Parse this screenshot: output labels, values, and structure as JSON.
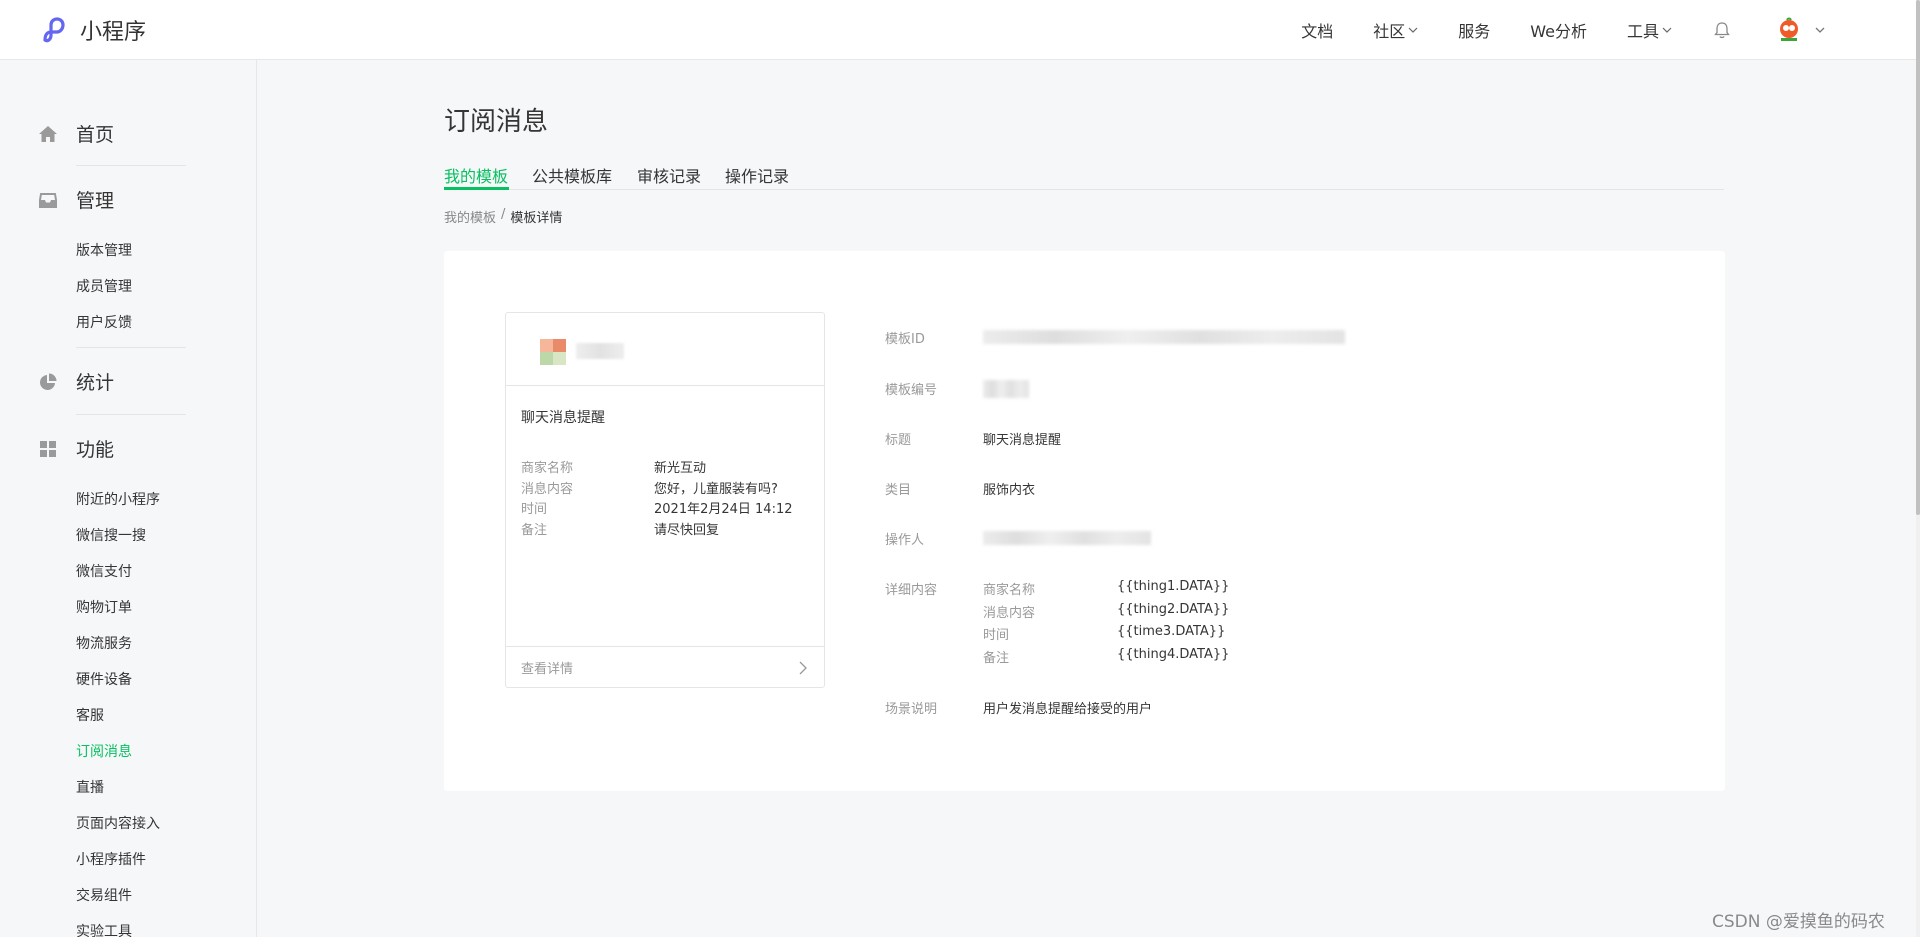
{
  "header": {
    "logo_text": "小程序",
    "nav": [
      {
        "label": "文档",
        "dropdown": false
      },
      {
        "label": "社区",
        "dropdown": true
      },
      {
        "label": "服务",
        "dropdown": false
      },
      {
        "label": "We分析",
        "dropdown": false
      },
      {
        "label": "工具",
        "dropdown": true
      }
    ],
    "icons": {
      "bell": "bell-icon",
      "avatar": "account-avatar",
      "chevron": "chevron-down-icon"
    }
  },
  "sidebar": {
    "home": "首页",
    "manage": {
      "label": "管理",
      "items": [
        "版本管理",
        "成员管理",
        "用户反馈"
      ]
    },
    "stats": "统计",
    "features": {
      "label": "功能",
      "items": [
        "附近的小程序",
        "微信搜一搜",
        "微信支付",
        "购物订单",
        "物流服务",
        "硬件设备",
        "客服",
        "订阅消息",
        "直播",
        "页面内容接入",
        "小程序插件",
        "交易组件",
        "实验工具"
      ],
      "active": "订阅消息"
    }
  },
  "main": {
    "title": "订阅消息",
    "tabs": [
      "我的模板",
      "公共模板库",
      "审核记录",
      "操作记录"
    ],
    "active_tab": "我的模板",
    "breadcrumb": {
      "parent": "我的模板",
      "separator": "/",
      "current": "模板详情"
    },
    "preview_card": {
      "title": "聊天消息提醒",
      "rows": [
        {
          "key": "商家名称",
          "value": "新光互动"
        },
        {
          "key": "消息内容",
          "value": "您好，儿童服装有吗?"
        },
        {
          "key": "时间",
          "value": "2021年2月24日 14:12"
        },
        {
          "key": "备注",
          "value": "请尽快回复"
        }
      ],
      "footer": "查看详情"
    },
    "details": {
      "template_id_label": "模板ID",
      "template_no_label": "模板编号",
      "title_label": "标题",
      "title_value": "聊天消息提醒",
      "category_label": "类目",
      "category_value": "服饰内衣",
      "operator_label": "操作人",
      "content_label": "详细内容",
      "content_rows": [
        {
          "key": "商家名称",
          "value": "{{thing1.DATA}}"
        },
        {
          "key": "消息内容",
          "value": "{{thing2.DATA}}"
        },
        {
          "key": "时间",
          "value": "{{time3.DATA}}"
        },
        {
          "key": "备注",
          "value": "{{thing4.DATA}}"
        }
      ],
      "scene_label": "场景说明",
      "scene_value": "用户发消息提醒给接受的用户"
    }
  },
  "watermark": "CSDN @爱摸鱼的码农",
  "colors": {
    "accent": "#07c160",
    "text": "#353535",
    "muted": "#9a9a9a",
    "background": "#f6f7f9"
  }
}
